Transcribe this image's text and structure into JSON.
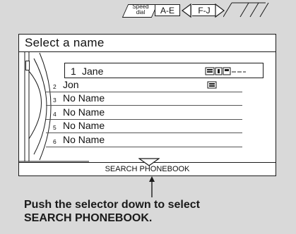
{
  "header": {
    "title": "Select a name",
    "speed_dial_line1": "Speed",
    "speed_dial_line2": "dial",
    "tab_ae": "A-E",
    "tab_fj": "F-J"
  },
  "list": [
    {
      "num": "1",
      "name": "Jane"
    },
    {
      "num": "2",
      "name": "Jon"
    },
    {
      "num": "3",
      "name": "No Name"
    },
    {
      "num": "4",
      "name": "No Name"
    },
    {
      "num": "5",
      "name": "No Name"
    },
    {
      "num": "6",
      "name": "No Name"
    }
  ],
  "search_label": "SEARCH PHONEBOOK",
  "caption": {
    "line1": "Push the selector down to select",
    "line2": "SEARCH PHONEBOOK."
  }
}
